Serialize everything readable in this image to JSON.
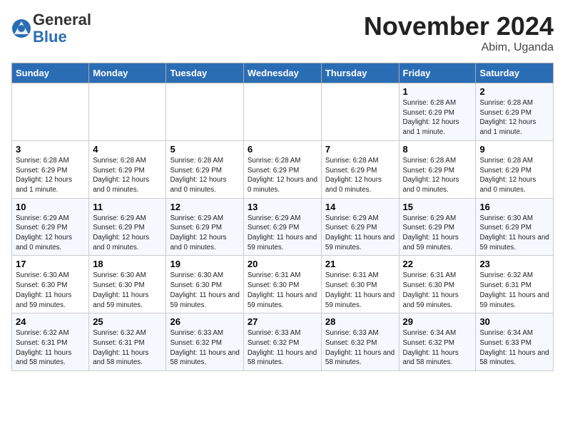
{
  "logo": {
    "general": "General",
    "blue": "Blue"
  },
  "title": "November 2024",
  "location": "Abim, Uganda",
  "days_of_week": [
    "Sunday",
    "Monday",
    "Tuesday",
    "Wednesday",
    "Thursday",
    "Friday",
    "Saturday"
  ],
  "weeks": [
    [
      {
        "num": "",
        "detail": ""
      },
      {
        "num": "",
        "detail": ""
      },
      {
        "num": "",
        "detail": ""
      },
      {
        "num": "",
        "detail": ""
      },
      {
        "num": "",
        "detail": ""
      },
      {
        "num": "1",
        "detail": "Sunrise: 6:28 AM\nSunset: 6:29 PM\nDaylight: 12 hours and 1 minute."
      },
      {
        "num": "2",
        "detail": "Sunrise: 6:28 AM\nSunset: 6:29 PM\nDaylight: 12 hours and 1 minute."
      }
    ],
    [
      {
        "num": "3",
        "detail": "Sunrise: 6:28 AM\nSunset: 6:29 PM\nDaylight: 12 hours and 1 minute."
      },
      {
        "num": "4",
        "detail": "Sunrise: 6:28 AM\nSunset: 6:29 PM\nDaylight: 12 hours and 0 minutes."
      },
      {
        "num": "5",
        "detail": "Sunrise: 6:28 AM\nSunset: 6:29 PM\nDaylight: 12 hours and 0 minutes."
      },
      {
        "num": "6",
        "detail": "Sunrise: 6:28 AM\nSunset: 6:29 PM\nDaylight: 12 hours and 0 minutes."
      },
      {
        "num": "7",
        "detail": "Sunrise: 6:28 AM\nSunset: 6:29 PM\nDaylight: 12 hours and 0 minutes."
      },
      {
        "num": "8",
        "detail": "Sunrise: 6:28 AM\nSunset: 6:29 PM\nDaylight: 12 hours and 0 minutes."
      },
      {
        "num": "9",
        "detail": "Sunrise: 6:28 AM\nSunset: 6:29 PM\nDaylight: 12 hours and 0 minutes."
      }
    ],
    [
      {
        "num": "10",
        "detail": "Sunrise: 6:29 AM\nSunset: 6:29 PM\nDaylight: 12 hours and 0 minutes."
      },
      {
        "num": "11",
        "detail": "Sunrise: 6:29 AM\nSunset: 6:29 PM\nDaylight: 12 hours and 0 minutes."
      },
      {
        "num": "12",
        "detail": "Sunrise: 6:29 AM\nSunset: 6:29 PM\nDaylight: 12 hours and 0 minutes."
      },
      {
        "num": "13",
        "detail": "Sunrise: 6:29 AM\nSunset: 6:29 PM\nDaylight: 11 hours and 59 minutes."
      },
      {
        "num": "14",
        "detail": "Sunrise: 6:29 AM\nSunset: 6:29 PM\nDaylight: 11 hours and 59 minutes."
      },
      {
        "num": "15",
        "detail": "Sunrise: 6:29 AM\nSunset: 6:29 PM\nDaylight: 11 hours and 59 minutes."
      },
      {
        "num": "16",
        "detail": "Sunrise: 6:30 AM\nSunset: 6:29 PM\nDaylight: 11 hours and 59 minutes."
      }
    ],
    [
      {
        "num": "17",
        "detail": "Sunrise: 6:30 AM\nSunset: 6:30 PM\nDaylight: 11 hours and 59 minutes."
      },
      {
        "num": "18",
        "detail": "Sunrise: 6:30 AM\nSunset: 6:30 PM\nDaylight: 11 hours and 59 minutes."
      },
      {
        "num": "19",
        "detail": "Sunrise: 6:30 AM\nSunset: 6:30 PM\nDaylight: 11 hours and 59 minutes."
      },
      {
        "num": "20",
        "detail": "Sunrise: 6:31 AM\nSunset: 6:30 PM\nDaylight: 11 hours and 59 minutes."
      },
      {
        "num": "21",
        "detail": "Sunrise: 6:31 AM\nSunset: 6:30 PM\nDaylight: 11 hours and 59 minutes."
      },
      {
        "num": "22",
        "detail": "Sunrise: 6:31 AM\nSunset: 6:30 PM\nDaylight: 11 hours and 59 minutes."
      },
      {
        "num": "23",
        "detail": "Sunrise: 6:32 AM\nSunset: 6:31 PM\nDaylight: 11 hours and 59 minutes."
      }
    ],
    [
      {
        "num": "24",
        "detail": "Sunrise: 6:32 AM\nSunset: 6:31 PM\nDaylight: 11 hours and 58 minutes."
      },
      {
        "num": "25",
        "detail": "Sunrise: 6:32 AM\nSunset: 6:31 PM\nDaylight: 11 hours and 58 minutes."
      },
      {
        "num": "26",
        "detail": "Sunrise: 6:33 AM\nSunset: 6:32 PM\nDaylight: 11 hours and 58 minutes."
      },
      {
        "num": "27",
        "detail": "Sunrise: 6:33 AM\nSunset: 6:32 PM\nDaylight: 11 hours and 58 minutes."
      },
      {
        "num": "28",
        "detail": "Sunrise: 6:33 AM\nSunset: 6:32 PM\nDaylight: 11 hours and 58 minutes."
      },
      {
        "num": "29",
        "detail": "Sunrise: 6:34 AM\nSunset: 6:32 PM\nDaylight: 11 hours and 58 minutes."
      },
      {
        "num": "30",
        "detail": "Sunrise: 6:34 AM\nSunset: 6:33 PM\nDaylight: 11 hours and 58 minutes."
      }
    ]
  ]
}
